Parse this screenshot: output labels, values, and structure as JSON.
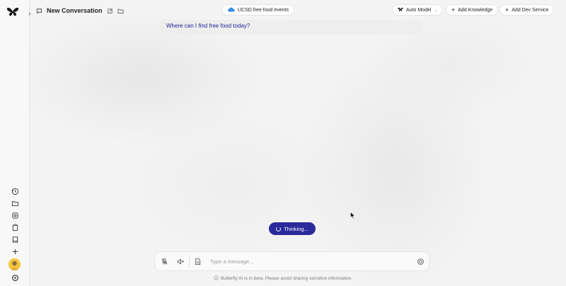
{
  "header": {
    "conversation_title": "New Conversation",
    "topic_pill": "UCSD free food events",
    "model_label": "Auto Model",
    "add_knowledge_label": "Add Knowledge",
    "add_dev_service_label": "Add Dev Service"
  },
  "conversation": {
    "user_message": "Where can I find free food today?",
    "status": "Thinking..."
  },
  "composer": {
    "placeholder": "Type a message..."
  },
  "footer": {
    "notice": "Butterfly AI is in beta. Please avoid sharing sensitive information."
  },
  "colors": {
    "accent": "#2b2a9a",
    "user_text": "#23239b",
    "cloud": "#3d8fe0"
  },
  "icons": {
    "sidebar": [
      "history-icon",
      "folder-icon",
      "settings-cog-icon",
      "clipboard-icon",
      "book-icon",
      "sparkle-icon",
      "avatar",
      "help-circle-icon"
    ]
  }
}
